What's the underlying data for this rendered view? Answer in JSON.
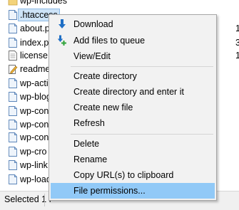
{
  "files": [
    {
      "name": "wp-includes",
      "type": "folder",
      "side": ""
    },
    {
      "name": ".htaccess",
      "type": "file",
      "side": "",
      "selected": true
    },
    {
      "name": "about.p",
      "type": "file",
      "side": "1"
    },
    {
      "name": "index.p",
      "type": "file",
      "side": "3"
    },
    {
      "name": "license.",
      "type": "text",
      "side": "1"
    },
    {
      "name": "readme",
      "type": "edit",
      "side": ""
    },
    {
      "name": "wp-acti",
      "type": "file",
      "side": ""
    },
    {
      "name": "wp-blog",
      "type": "file",
      "side": ""
    },
    {
      "name": "wp-con",
      "type": "file",
      "side": ""
    },
    {
      "name": "wp-con",
      "type": "file",
      "side": ""
    },
    {
      "name": "wp-con",
      "type": "file",
      "side": ""
    },
    {
      "name": "wp-cro",
      "type": "file",
      "side": ""
    },
    {
      "name": "wp-link",
      "type": "file",
      "side": ""
    },
    {
      "name": "wp-load",
      "type": "file",
      "side": ""
    }
  ],
  "status": {
    "text": "Selected 1 f"
  },
  "menu": {
    "download": "Download",
    "add_to_queue": "Add files to queue",
    "view_edit": "View/Edit",
    "create_directory": "Create directory",
    "create_directory_enter": "Create directory and enter it",
    "create_new_file": "Create new file",
    "refresh": "Refresh",
    "delete": "Delete",
    "rename": "Rename",
    "copy_urls": "Copy URL(s) to clipboard",
    "file_permissions": "File permissions..."
  },
  "colors": {
    "highlight": "#91c9f7",
    "download_arrow": "#1f6fc5",
    "queue_plus": "#2fa33a"
  }
}
